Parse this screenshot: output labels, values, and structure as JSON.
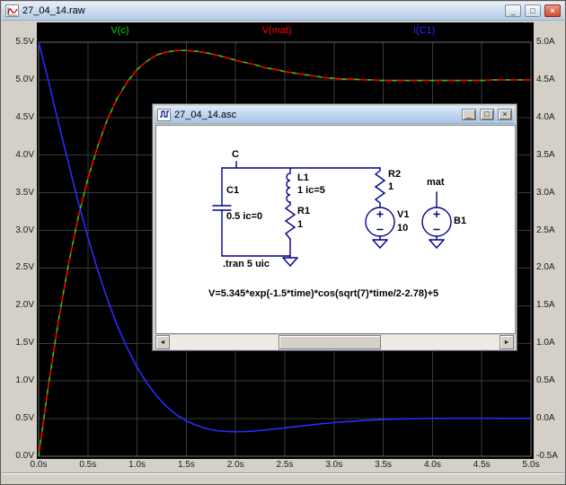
{
  "window": {
    "title": "27_04_14.raw"
  },
  "icons": {
    "minimize": "_",
    "maximize": "□",
    "close": "×",
    "scroll_left": "◄",
    "scroll_right": "►"
  },
  "schematic_window": {
    "title": "27_04_14.asc",
    "directive": ".tran 5 uic",
    "formula": "V=5.345*exp(-1.5*time)*cos(sqrt(7)*time/2-2.78)+5",
    "labels": {
      "node_c": "C",
      "c1_name": "C1",
      "c1_value": "0.5 ic=0",
      "l1_name": "L1",
      "l1_value": "1 ic=5",
      "r1_name": "R1",
      "r1_value": "1",
      "r2_name": "R2",
      "r2_value": "1",
      "v1_name": "V1",
      "v1_value": "10",
      "b1_name": "B1",
      "node_mat": "mat"
    }
  },
  "chart_data": {
    "type": "line",
    "title": "",
    "bg": "#000000",
    "grid_color": "#3a3a3a",
    "border_color": "#6e6e6e",
    "grid": true,
    "x": {
      "min": 0,
      "max": 5,
      "ticks": [
        "0.0s",
        "0.5s",
        "1.0s",
        "1.5s",
        "2.0s",
        "2.5s",
        "3.0s",
        "3.5s",
        "4.0s",
        "4.5s",
        "5.0s"
      ]
    },
    "y_left": {
      "min": 0,
      "max": 5.5,
      "ticks_top_to_bottom": [
        "5.5V",
        "5.0V",
        "4.5V",
        "4.0V",
        "3.5V",
        "3.0V",
        "2.5V",
        "2.0V",
        "1.5V",
        "1.0V",
        "0.5V",
        "0.0V"
      ]
    },
    "y_right": {
      "min": -0.5,
      "max": 5.0,
      "ticks_top_to_bottom": [
        "5.0A",
        "4.5A",
        "4.0A",
        "3.5A",
        "3.0A",
        "2.5A",
        "2.0A",
        "1.5A",
        "1.0A",
        "0.5A",
        "0.0A",
        "-0.5A"
      ]
    },
    "t_start": 0,
    "t_step": 0.1,
    "series": [
      {
        "name": "V(c)",
        "color": "#00dc00",
        "axis": "left",
        "dashed": true,
        "label_fraction": 0.165,
        "values": [
          0.0,
          0.95,
          1.79,
          2.53,
          3.16,
          3.69,
          4.12,
          4.48,
          4.76,
          4.97,
          5.14,
          5.25,
          5.33,
          5.37,
          5.39,
          5.39,
          5.38,
          5.36,
          5.33,
          5.3,
          5.26,
          5.23,
          5.2,
          5.16,
          5.14,
          5.11,
          5.09,
          5.07,
          5.05,
          5.03,
          5.02,
          5.01,
          5.01,
          5.0,
          5.0,
          4.99,
          4.99,
          4.99,
          4.99,
          4.99,
          4.99,
          4.99,
          4.99,
          4.99,
          4.99,
          4.99,
          5.0,
          5.0,
          5.0,
          5.0,
          5.0
        ]
      },
      {
        "name": "V(mat)",
        "color": "#ff0000",
        "axis": "left",
        "dashed": false,
        "label_fraction": 0.484,
        "values": [
          0.0,
          0.95,
          1.79,
          2.53,
          3.16,
          3.69,
          4.12,
          4.48,
          4.76,
          4.97,
          5.14,
          5.25,
          5.33,
          5.37,
          5.39,
          5.39,
          5.38,
          5.36,
          5.33,
          5.3,
          5.26,
          5.23,
          5.2,
          5.16,
          5.14,
          5.11,
          5.09,
          5.07,
          5.05,
          5.03,
          5.02,
          5.01,
          5.01,
          5.0,
          5.0,
          4.99,
          4.99,
          4.99,
          4.99,
          4.99,
          4.99,
          4.99,
          4.99,
          4.99,
          4.99,
          4.99,
          5.0,
          5.0,
          5.0,
          5.0,
          5.0
        ]
      },
      {
        "name": "I(C1)",
        "color": "#2a2aff",
        "axis": "right",
        "dashed": false,
        "label_fraction": 0.783,
        "values": [
          5.0,
          4.48,
          3.94,
          3.41,
          2.89,
          2.41,
          1.97,
          1.58,
          1.23,
          0.94,
          0.68,
          0.47,
          0.3,
          0.16,
          0.05,
          -0.03,
          -0.09,
          -0.13,
          -0.16,
          -0.17,
          -0.174,
          -0.172,
          -0.164,
          -0.152,
          -0.138,
          -0.123,
          -0.108,
          -0.093,
          -0.079,
          -0.065,
          -0.053,
          -0.042,
          -0.033,
          -0.025,
          -0.018,
          -0.012,
          -0.007,
          -0.004,
          -0.001,
          0.001,
          0.003,
          0.004,
          0.005,
          0.005,
          0.005,
          0.005,
          0.005,
          0.004,
          0.004,
          0.003,
          0.003
        ]
      }
    ]
  }
}
